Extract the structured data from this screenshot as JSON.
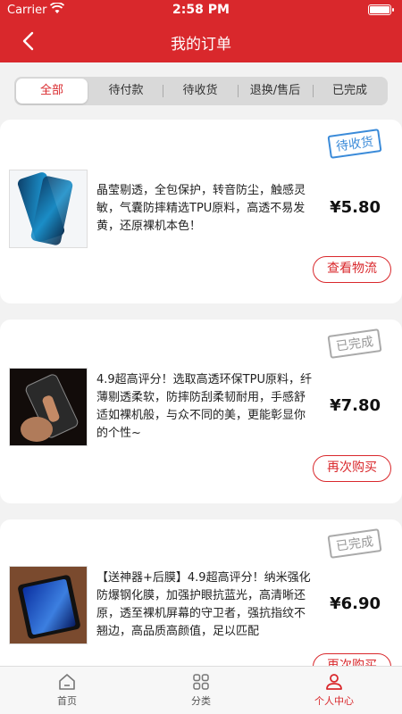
{
  "status_bar": {
    "carrier": "Carrier",
    "time": "2:58 PM"
  },
  "header": {
    "title": "我的订单"
  },
  "tabs": [
    {
      "label": "全部",
      "active": true
    },
    {
      "label": "待付款"
    },
    {
      "label": "待收货"
    },
    {
      "label": "退换/售后"
    },
    {
      "label": "已完成"
    }
  ],
  "orders": [
    {
      "status": "待收货",
      "description": "晶莹剔透，全包保护，转音防尘，触感灵敏，气囊防摔精选TPU原料，高透不易发黄，还原裸机本色！",
      "price": "¥5.80",
      "action": "查看物流"
    },
    {
      "status": "已完成",
      "description": "4.9超高评分！选取高透环保TPU原料，纤薄剔透柔软，防摔防刮柔韧耐用，手感舒适如裸机般，与众不同的美，更能彰显你的个性~",
      "price": "¥7.80",
      "action": "再次购买"
    },
    {
      "status": "已完成",
      "description": "【送神器+后膜】4.9超高评分！纳米强化防爆钢化膜，加强护眼抗蓝光，高清晰还原，透至裸机屏幕的守卫者，强抗指纹不翘边，高品质高颜值，足以匹配",
      "price": "¥6.90",
      "action": "再次购买"
    }
  ],
  "bottom_nav": [
    {
      "label": "首页",
      "icon": "home-icon"
    },
    {
      "label": "分类",
      "icon": "grid-icon"
    },
    {
      "label": "个人中心",
      "icon": "user-icon",
      "active": true
    }
  ],
  "colors": {
    "brand": "#d9282c",
    "stamp_blue": "#3b8bd9",
    "stamp_gray": "#999999"
  }
}
